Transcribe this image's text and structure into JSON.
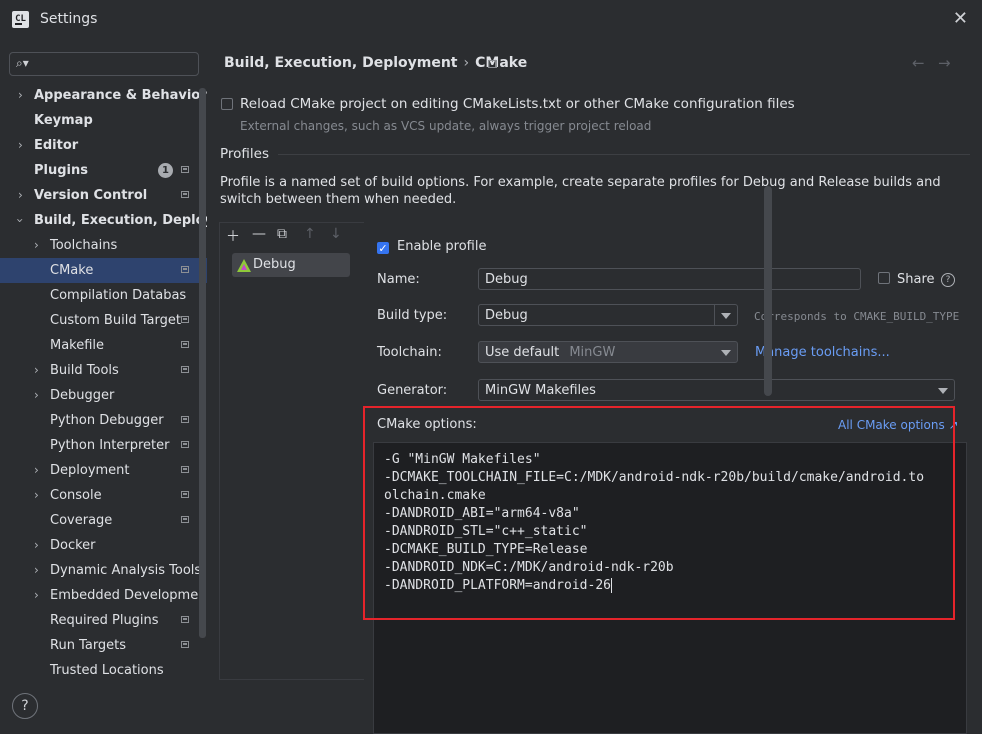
{
  "window": {
    "app_icon_text": "CL",
    "title": "Settings"
  },
  "search": {
    "placeholder": ""
  },
  "tree": {
    "appearance": "Appearance & Behavior",
    "keymap": "Keymap",
    "editor": "Editor",
    "plugins": "Plugins",
    "plugins_badge": "1",
    "version_control": "Version Control",
    "build_exec_deploy": "Build, Execution, Deploym",
    "toolchains": "Toolchains",
    "cmake": "CMake",
    "compilation_db": "Compilation Databas",
    "custom_build_targets": "Custom Build Target",
    "makefile": "Makefile",
    "build_tools": "Build Tools",
    "debugger": "Debugger",
    "python_debugger": "Python Debugger",
    "python_interpreter": "Python Interpreter",
    "deployment": "Deployment",
    "console": "Console",
    "coverage": "Coverage",
    "docker": "Docker",
    "dynamic_analysis": "Dynamic Analysis Tools",
    "embedded": "Embedded Developme",
    "required_plugins": "Required Plugins",
    "run_targets": "Run Targets",
    "trusted_locations": "Trusted Locations"
  },
  "breadcrumb": {
    "parent": "Build, Execution, Deployment",
    "separator": "›",
    "current": "CMake"
  },
  "reload": {
    "label": "Reload CMake project on editing CMakeLists.txt or other CMake configuration files",
    "hint": "External changes, such as VCS update, always trigger project reload",
    "checked": false
  },
  "profiles": {
    "title": "Profiles",
    "description": "Profile is a named set of build options. For example, create separate profiles for Debug and Release builds and switch between them when needed.",
    "list": [
      "Debug"
    ]
  },
  "profile": {
    "enable_label": "Enable profile",
    "enabled": true,
    "name_label": "Name:",
    "name_value": "Debug",
    "share_label": "Share",
    "build_type_label": "Build type:",
    "build_type_value": "Debug",
    "build_type_hint": "Corresponds to CMAKE_BUILD_TYPE",
    "toolchain_label": "Toolchain:",
    "toolchain_value": "Use default",
    "toolchain_default": "MinGW",
    "manage_toolchains": "Manage toolchains...",
    "generator_label": "Generator:",
    "generator_value": "MinGW Makefiles",
    "cmake_options_label": "CMake options:",
    "all_cmake_options": "All CMake options ↗",
    "cmake_options_text": "-G \"MinGW Makefiles\"\n-DCMAKE_TOOLCHAIN_FILE=C:/MDK/android-ndk-r20b/build/cmake/android.to\nolchain.cmake\n-DANDROID_ABI=\"arm64-v8a\"\n-DANDROID_STL=\"c++_static\"\n-DCMAKE_BUILD_TYPE=Release\n-DANDROID_NDK=C:/MDK/android-ndk-r20b\n-DANDROID_PLATFORM=android-26"
  },
  "colors": {
    "accent": "#3574f0",
    "selection": "#2e436e",
    "link": "#6a9df5",
    "highlight_box": "#e5242b"
  }
}
